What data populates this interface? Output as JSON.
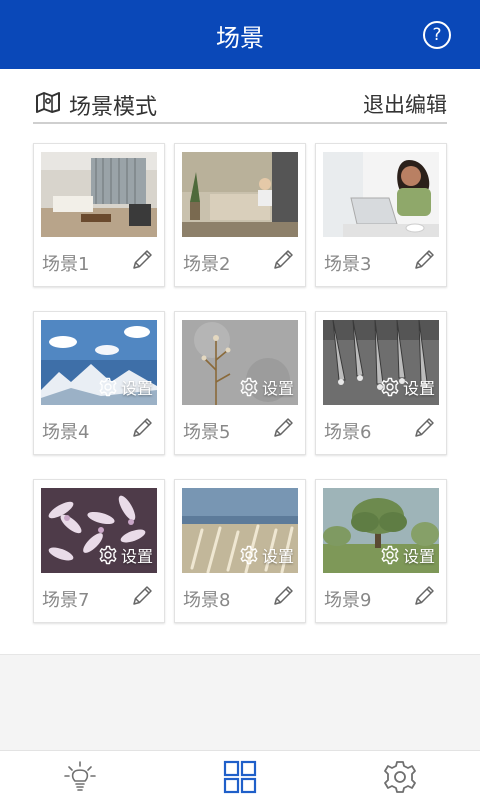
{
  "header": {
    "title": "场景",
    "help_glyph": "?"
  },
  "section": {
    "title": "场景模式",
    "exit_edit_label": "退出编辑",
    "icon": "map-icon"
  },
  "scenes": [
    {
      "label": "场景1",
      "has_settings": false
    },
    {
      "label": "场景2",
      "has_settings": false
    },
    {
      "label": "场景3",
      "has_settings": false
    },
    {
      "label": "场景4",
      "has_settings": true,
      "settings_label": "设置"
    },
    {
      "label": "场景5",
      "has_settings": true,
      "settings_label": "设置"
    },
    {
      "label": "场景6",
      "has_settings": true,
      "settings_label": "设置"
    },
    {
      "label": "场景7",
      "has_settings": true,
      "settings_label": "设置"
    },
    {
      "label": "场景8",
      "has_settings": true,
      "settings_label": "设置"
    },
    {
      "label": "场景9",
      "has_settings": true,
      "settings_label": "设置"
    }
  ],
  "bottom_nav": [
    {
      "name": "lightbulb-icon",
      "active": false
    },
    {
      "name": "grid-icon",
      "active": true
    },
    {
      "name": "gear-icon",
      "active": false
    }
  ],
  "colors": {
    "primary": "#0a48b8",
    "label_gray": "#888888",
    "active_nav": "#1f5fc9",
    "inactive_nav": "#6f6f6f"
  }
}
